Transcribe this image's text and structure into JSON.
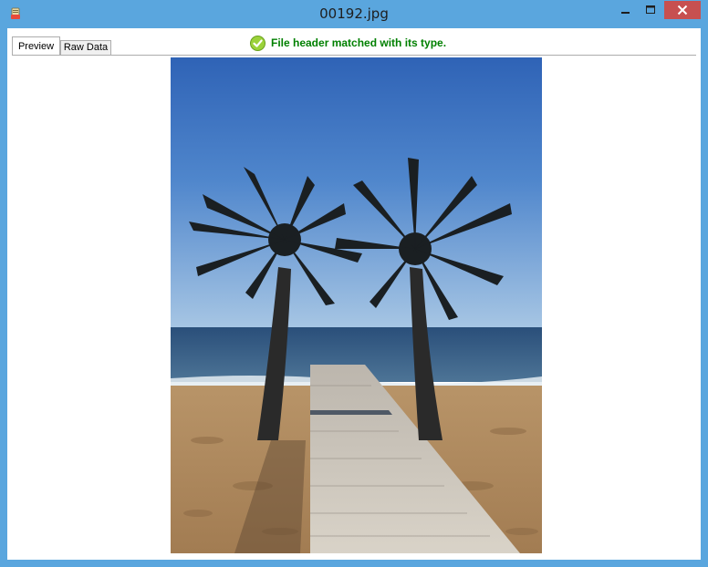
{
  "window": {
    "title": "00192.jpg"
  },
  "tabs": [
    {
      "label": "Preview",
      "active": true
    },
    {
      "label": "Raw Data",
      "active": false
    }
  ],
  "status": {
    "message": "File header matched with its type.",
    "icon": "check-circle-icon",
    "color": "#008000"
  },
  "preview": {
    "subject": "two palm trees on a sandy beach with a wooden boardwalk leading to the sea"
  },
  "colors": {
    "frame": "#5aa6de",
    "close_button": "#c75050"
  }
}
